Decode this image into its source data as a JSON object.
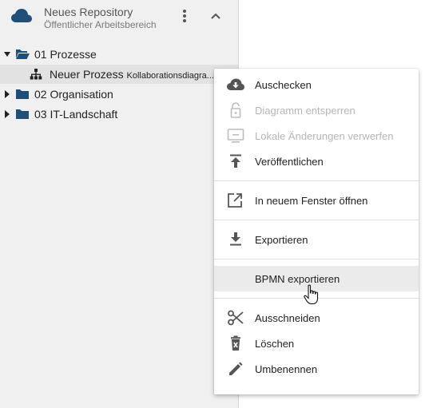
{
  "repository": {
    "title": "Neues Repository",
    "subtitle": "Öffentlicher Arbeitsbereich"
  },
  "tree": {
    "items": [
      {
        "label": "01 Prozesse",
        "expanded": true
      },
      {
        "label": "02 Organisation",
        "expanded": false
      },
      {
        "label": "03 IT-Landschaft",
        "expanded": false
      }
    ],
    "child": {
      "label": "Neuer Prozess",
      "type": "Kollaborationsdiagra..."
    }
  },
  "context_menu": {
    "items": [
      {
        "label": "Auschecken",
        "icon": "cloud-download-icon",
        "enabled": true
      },
      {
        "label": "Diagramm entsperren",
        "icon": "lock-open-icon",
        "enabled": false
      },
      {
        "label": "Lokale Änderungen verwerfen",
        "icon": "discard-icon",
        "enabled": false
      },
      {
        "label": "Veröffentlichen",
        "icon": "publish-icon",
        "enabled": true
      },
      {
        "label": "In neuem Fenster öffnen",
        "icon": "open-new-window-icon",
        "enabled": true
      },
      {
        "label": "Exportieren",
        "icon": "download-icon",
        "enabled": true
      },
      {
        "label": "BPMN exportieren",
        "icon": "",
        "enabled": true,
        "hovered": true
      },
      {
        "label": "Ausschneiden",
        "icon": "scissors-icon",
        "enabled": true
      },
      {
        "label": "Löschen",
        "icon": "trash-icon",
        "enabled": true
      },
      {
        "label": "Umbenennen",
        "icon": "pencil-icon",
        "enabled": true
      }
    ]
  },
  "colors": {
    "accent": "#1f4e79",
    "sidebar_bg": "#f0f0f0",
    "icon": "#555555",
    "disabled": "#b6b6b6",
    "hover_bg": "#ebebeb"
  }
}
